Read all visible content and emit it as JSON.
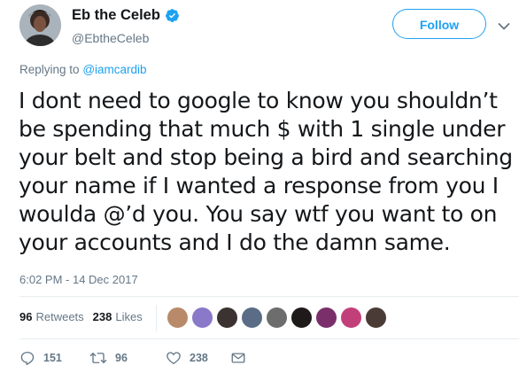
{
  "author": {
    "display_name": "Eb the Celeb",
    "handle": "@EbtheCeleb",
    "verified": true
  },
  "follow_button": {
    "label": "Follow"
  },
  "replying": {
    "prefix": "Replying to",
    "mention": "@iamcardib"
  },
  "tweet": {
    "lines": [
      "I dont need to google to know you shouldn’t",
      "be spending that much $ with 1 single under",
      "your belt and stop being a bird and searching",
      "your name if I wanted a response from you I",
      "woulda @’d you. You say wtf you want to on",
      "your accounts and I do the damn same."
    ]
  },
  "timestamp": "6:02 PM - 14 Dec 2017",
  "stats": {
    "retweets_count": "96",
    "retweets_label": "Retweets",
    "likes_count": "238",
    "likes_label": "Likes"
  },
  "likers": [
    {
      "color": "#b98a6a"
    },
    {
      "color": "#8a78c8"
    },
    {
      "color": "#3b3232"
    },
    {
      "color": "#5a6c86"
    },
    {
      "color": "#6d6d6d"
    },
    {
      "color": "#1f1a1a"
    },
    {
      "color": "#7a2f6a"
    },
    {
      "color": "#c2407a"
    },
    {
      "color": "#4a3b36"
    }
  ],
  "actions": {
    "reply_count": "151",
    "retweet_count": "96",
    "like_count": "238"
  },
  "colors": {
    "accent": "#1da1f2",
    "text_primary": "#14171a",
    "text_secondary": "#657786",
    "divider": "#e6ecf0"
  },
  "icons": {
    "verified": "verified-badge-icon",
    "caret": "chevron-down-icon",
    "reply": "reply-icon",
    "retweet": "retweet-icon",
    "like": "heart-icon",
    "dm": "envelope-icon"
  }
}
